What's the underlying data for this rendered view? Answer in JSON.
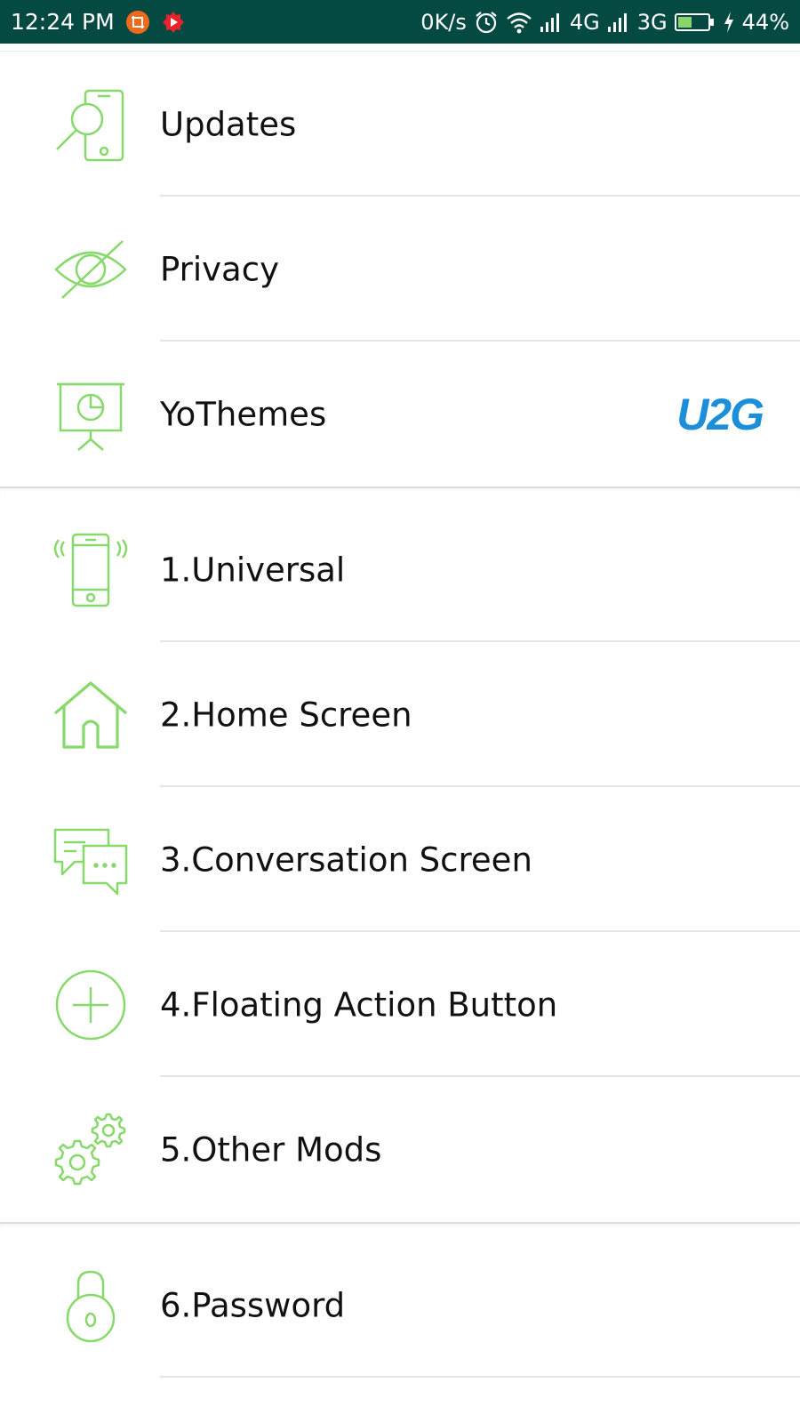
{
  "status_bar": {
    "time": "12:24 PM",
    "speed": "0K/s",
    "network_1": "4G",
    "network_2": "3G",
    "battery": "44%",
    "background_color": "#054a42"
  },
  "accent_color": "#86d96a",
  "menu": {
    "section_1": [
      {
        "label": "Updates",
        "icon": "phone-search-icon"
      },
      {
        "label": "Privacy",
        "icon": "eye-off-icon"
      },
      {
        "label": "YoThemes",
        "icon": "presentation-board-icon"
      }
    ],
    "section_2": [
      {
        "label": "1.Universal",
        "icon": "phone-vibrate-icon"
      },
      {
        "label": "2.Home Screen",
        "icon": "home-icon"
      },
      {
        "label": "3.Conversation Screen",
        "icon": "chat-bubbles-icon"
      },
      {
        "label": "4.Floating Action Button",
        "icon": "plus-circle-icon"
      },
      {
        "label": "5.Other Mods",
        "icon": "gears-icon"
      }
    ],
    "section_3": [
      {
        "label": "6.Password",
        "icon": "padlock-icon"
      }
    ]
  },
  "watermark": {
    "text": "U2G",
    "color": "#1d8fd9"
  }
}
